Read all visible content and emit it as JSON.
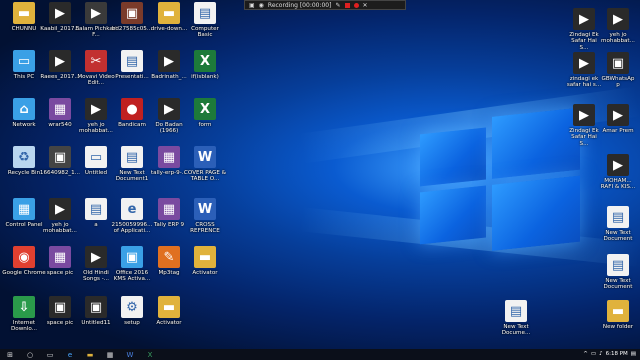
{
  "recording_bar": {
    "label": "Recording [00:00:00]"
  },
  "desktop_icons": [
    {
      "label": "CHUNNU",
      "color": "#e0b23c",
      "glyph": "▬"
    },
    {
      "label": "Kaabil_2017...",
      "color": "#2a2a2a",
      "glyph": "▶"
    },
    {
      "label": "Balam Pichkari F...",
      "color": "#3a3a3a",
      "glyph": "▶"
    },
    {
      "label": "bd27585c05...",
      "color": "#7a3b2a",
      "glyph": "▣"
    },
    {
      "label": "drive-down...",
      "color": "#e0b23c",
      "glyph": "▬"
    },
    {
      "label": "Computer Basic",
      "color": "#f2f2f2",
      "glyph": "▤"
    },
    {
      "label": "This PC",
      "color": "#3aa0e6",
      "glyph": "▭"
    },
    {
      "label": "Raees_2017...",
      "color": "#2a2a2a",
      "glyph": "▶"
    },
    {
      "label": "Movavi Video Edit...",
      "color": "#c23030",
      "glyph": "✂"
    },
    {
      "label": "Presentati...",
      "color": "#f2f2f2",
      "glyph": "▤"
    },
    {
      "label": "Badrinath_...",
      "color": "#2a2a2a",
      "glyph": "▶"
    },
    {
      "label": "if(isblank)",
      "color": "#1d7a3a",
      "glyph": "X"
    },
    {
      "label": "Network",
      "color": "#3aa0e6",
      "glyph": "⌂"
    },
    {
      "label": "wrar540",
      "color": "#7a4aa0",
      "glyph": "▦"
    },
    {
      "label": "yeh jo mohabbat...",
      "color": "#2a2a2a",
      "glyph": "▶"
    },
    {
      "label": "Bandicam",
      "color": "#c02020",
      "glyph": "●"
    },
    {
      "label": "Do Badan (1966)",
      "color": "#2a2a2a",
      "glyph": "▶"
    },
    {
      "label": "form",
      "color": "#1d7a3a",
      "glyph": "X"
    },
    {
      "label": "Recycle Bin",
      "color": "#b9d6f0",
      "glyph": "♻"
    },
    {
      "label": "16640982_1...",
      "color": "#444",
      "glyph": "▣"
    },
    {
      "label": "Untitled",
      "color": "#f2f2f2",
      "glyph": "▭"
    },
    {
      "label": "New Text Document1",
      "color": "#f2f2f2",
      "glyph": "▤"
    },
    {
      "label": "tally-erp-9-...",
      "color": "#7a4aa0",
      "glyph": "▦"
    },
    {
      "label": "COVER PAGE & TABLE O...",
      "color": "#2b5fb8",
      "glyph": "W"
    },
    {
      "label": "Control Panel",
      "color": "#3aa0e6",
      "glyph": "▦"
    },
    {
      "label": "yeh jo mohabbat...",
      "color": "#2a2a2a",
      "glyph": "▶"
    },
    {
      "label": "a",
      "color": "#f2f2f2",
      "glyph": "▤"
    },
    {
      "label": "2150059996... of Applicati...",
      "color": "#f2f2f2",
      "glyph": "e"
    },
    {
      "label": "Tally ERP 9",
      "color": "#7a4aa0",
      "glyph": "▦"
    },
    {
      "label": "CROSS REFRENCE",
      "color": "#2b5fb8",
      "glyph": "W"
    },
    {
      "label": "Google Chrome",
      "color": "#e04030",
      "glyph": "◉"
    },
    {
      "label": "space pic",
      "color": "#7a4aa0",
      "glyph": "▦"
    },
    {
      "label": "Old Hindi Songs -...",
      "color": "#2a2a2a",
      "glyph": "▶"
    },
    {
      "label": "Office 2016 KMS Activa...",
      "color": "#3aa0e6",
      "glyph": "▣"
    },
    {
      "label": "Mp3tag",
      "color": "#e07020",
      "glyph": "✎"
    },
    {
      "label": "Activator",
      "color": "#e0b23c",
      "glyph": "▬"
    },
    {
      "label": "Internet Downlo...",
      "color": "#2a9a4a",
      "glyph": "⇩"
    },
    {
      "label": "space pic",
      "color": "#2a2a2a",
      "glyph": "▣"
    },
    {
      "label": "Untitled11",
      "color": "#2a2a2a",
      "glyph": "▣"
    },
    {
      "label": "setup",
      "color": "#f2f2f2",
      "glyph": "⚙"
    },
    {
      "label": "Activator",
      "color": "#e0b23c",
      "glyph": "▬"
    }
  ],
  "right_icons": [
    {
      "label": "Zindagi Ek Safar Hai S...",
      "color": "#2a2a2a",
      "glyph": "▶"
    },
    {
      "label": "yeh jo mohabbat...",
      "color": "#2a2a2a",
      "glyph": "▶"
    },
    {
      "label": "zindagi ek safar hai s...",
      "color": "#2a2a2a",
      "glyph": "▶"
    },
    {
      "label": "GBWhatsApp",
      "color": "#2a2a2a",
      "glyph": "▣"
    },
    {
      "label": "Zindagi Ek Safar Hai S...",
      "color": "#2a2a2a",
      "glyph": "▶"
    },
    {
      "label": "Amar Prem",
      "color": "#2a2a2a",
      "glyph": "▶"
    },
    {
      "label": "MOHAM... RAFI & KIS...",
      "color": "#2a2a2a",
      "glyph": "▶"
    },
    {
      "label": "New Text Document",
      "color": "#f2f2f2",
      "glyph": "▤"
    },
    {
      "label": "New Text Document",
      "color": "#f2f2f2",
      "glyph": "▤"
    },
    {
      "label": "New Text Docume...",
      "color": "#f2f2f2",
      "glyph": "▤"
    },
    {
      "label": "New folder",
      "color": "#e0b23c",
      "glyph": "▬"
    }
  ],
  "taskbar": {
    "time": "6:18 PM"
  }
}
